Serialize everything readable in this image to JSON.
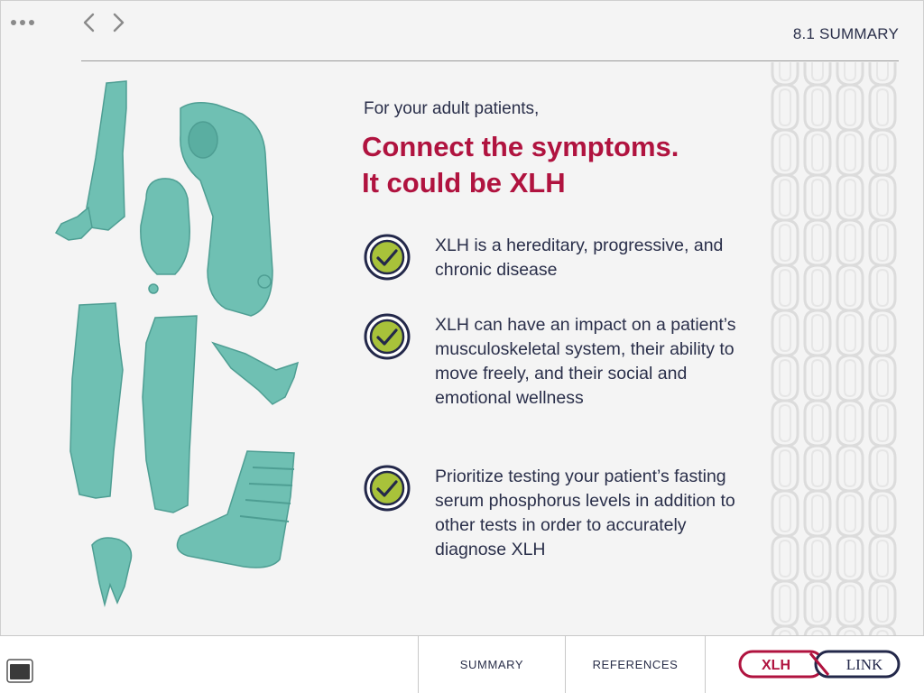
{
  "header": {
    "section_title": "8.1 SUMMARY",
    "menu_icon": "more-dots-icon",
    "back_icon": "chevron-left-icon",
    "forward_icon": "chevron-right-icon"
  },
  "main": {
    "intro": "For your adult patients,",
    "headline_line1": "Connect the symptoms.",
    "headline_line2": "It could be XLH",
    "points": [
      {
        "icon": "checkmark-circle-icon",
        "text": "XLH is a hereditary, progressive, and chronic disease"
      },
      {
        "icon": "checkmark-circle-icon",
        "text": "XLH can have an impact on a patient’s musculoskeletal system, their ability to move freely, and their social and emotional wellness"
      },
      {
        "icon": "checkmark-circle-icon",
        "text": "Prioritize testing your patient’s fasting serum phosphorus levels in addition to other tests in order to accurately diagnose XLH"
      }
    ]
  },
  "footer": {
    "summary_label": "SUMMARY",
    "references_label": "REFERENCES",
    "logo_left": "XLH",
    "logo_right": "LINK"
  },
  "colors": {
    "accent": "#b0133f",
    "navy": "#23284a",
    "check_green": "#a8c23a",
    "figure_teal": "#6fc0b3",
    "background": "#f4f4f4"
  }
}
